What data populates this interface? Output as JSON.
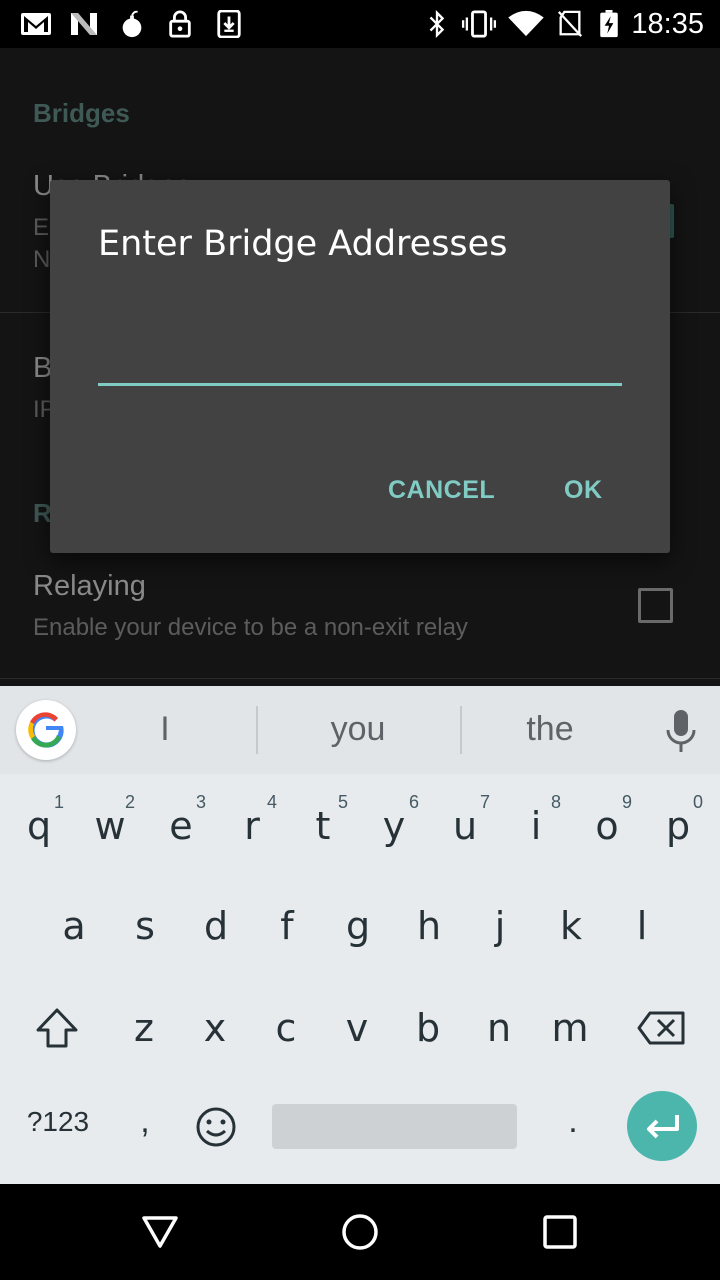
{
  "status_bar": {
    "time": "18:35",
    "icons": [
      "gmail-icon",
      "n-icon",
      "bomb-icon",
      "lock-icon",
      "download-icon",
      "bluetooth-icon",
      "vibrate-icon",
      "wifi-icon",
      "no-sim-icon",
      "battery-charging-icon"
    ]
  },
  "settings": {
    "category_bridges": "Bridges",
    "use_bridges_title": "Use Bridges",
    "use_bridges_summary_1": "E",
    "use_bridges_summary_2": "N",
    "bridges_title": "B",
    "bridges_summary": "IP",
    "category_relay": "R",
    "relaying_title": "Relaying",
    "relaying_summary": "Enable your device to be a non-exit relay"
  },
  "dialog": {
    "title": "Enter Bridge Addresses",
    "input_value": "",
    "cancel_label": "CANCEL",
    "ok_label": "OK"
  },
  "keyboard": {
    "suggestions": [
      "I",
      "you",
      "the"
    ],
    "row1": [
      "q",
      "w",
      "e",
      "r",
      "t",
      "y",
      "u",
      "i",
      "o",
      "p"
    ],
    "row1_hints": [
      "1",
      "2",
      "3",
      "4",
      "5",
      "6",
      "7",
      "8",
      "9",
      "0"
    ],
    "row2": [
      "a",
      "s",
      "d",
      "f",
      "g",
      "h",
      "j",
      "k",
      "l"
    ],
    "row3": [
      "z",
      "x",
      "c",
      "v",
      "b",
      "n",
      "m"
    ],
    "symbols_label": "?123",
    "comma_label": ",",
    "period_label": ".",
    "accent_color": "#4db6ac"
  },
  "colors": {
    "dialog_bg": "#424242",
    "accent": "#80cbc4"
  }
}
